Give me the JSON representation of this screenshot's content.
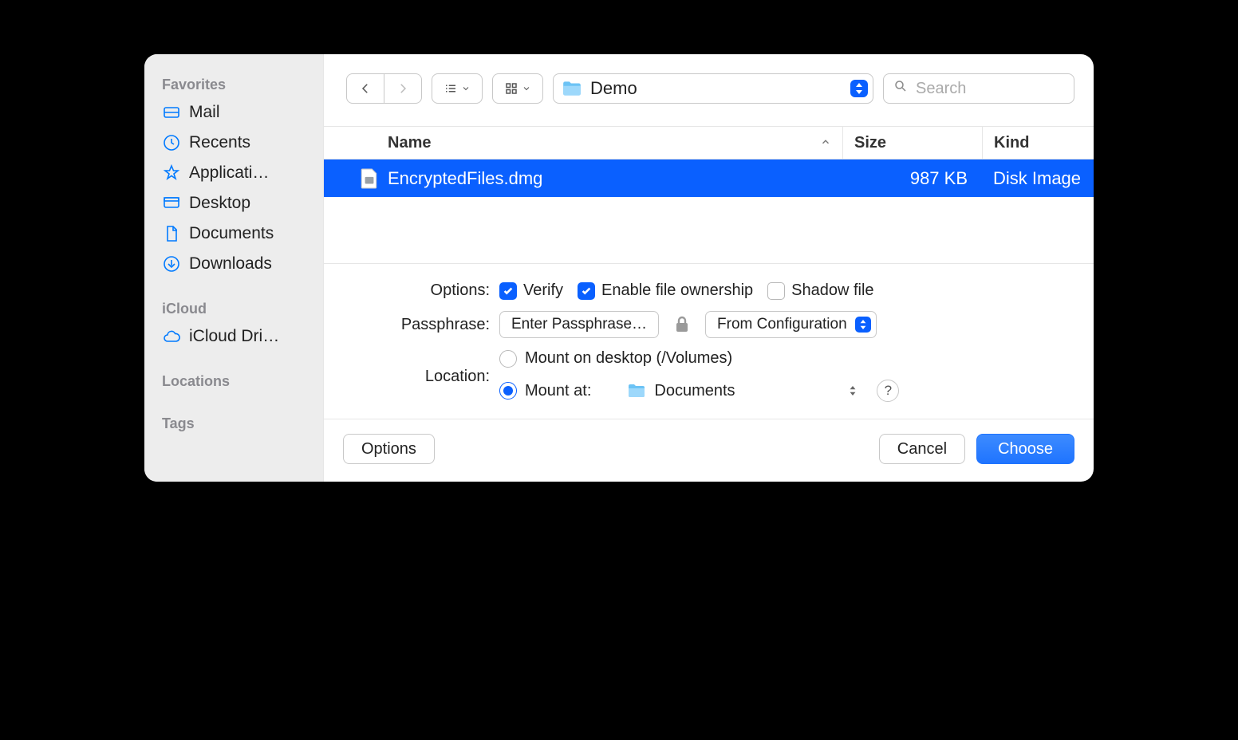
{
  "sidebar": {
    "sections": [
      {
        "title": "Favorites",
        "items": [
          {
            "id": "mail",
            "label": "Mail",
            "icon": "tray-icon"
          },
          {
            "id": "recents",
            "label": "Recents",
            "icon": "clock-icon"
          },
          {
            "id": "apps",
            "label": "Applicati…",
            "icon": "apps-icon"
          },
          {
            "id": "desktop",
            "label": "Desktop",
            "icon": "desktop-icon"
          },
          {
            "id": "documents",
            "label": "Documents",
            "icon": "document-icon"
          },
          {
            "id": "downloads",
            "label": "Downloads",
            "icon": "download-icon"
          }
        ]
      },
      {
        "title": "iCloud",
        "items": [
          {
            "id": "iclouddrive",
            "label": "iCloud Dri…",
            "icon": "cloud-icon"
          }
        ]
      },
      {
        "title": "Locations",
        "items": []
      },
      {
        "title": "Tags",
        "items": []
      }
    ]
  },
  "toolbar": {
    "path_label": "Demo",
    "search_placeholder": "Search"
  },
  "columns": {
    "name": "Name",
    "size": "Size",
    "kind": "Kind"
  },
  "rows": [
    {
      "name": "EncryptedFiles.dmg",
      "size": "987 KB",
      "kind": "Disk Image",
      "selected": true
    }
  ],
  "options": {
    "options_label": "Options:",
    "verify": {
      "label": "Verify",
      "checked": true
    },
    "ownership": {
      "label": "Enable file ownership",
      "checked": true
    },
    "shadow": {
      "label": "Shadow file",
      "checked": false
    },
    "passphrase_label": "Passphrase:",
    "passphrase_button": "Enter Passphrase…",
    "passphrase_source": "From Configuration",
    "location_label": "Location:",
    "mount_desktop_label": "Mount on desktop (/Volumes)",
    "mount_at_label": "Mount at:",
    "mount_at_value": "Documents",
    "mount_at_selected": true
  },
  "footer": {
    "options_button": "Options",
    "cancel": "Cancel",
    "choose": "Choose"
  }
}
